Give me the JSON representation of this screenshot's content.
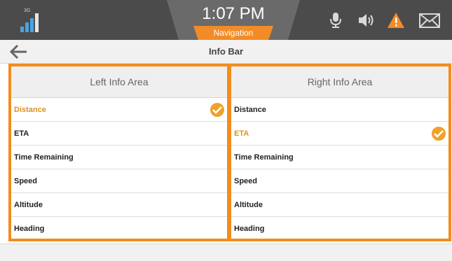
{
  "status_bar": {
    "network_label": "3G",
    "time": "1:07 PM",
    "mode_tab": "Navigation",
    "icons": [
      "signal-icon",
      "microphone-icon",
      "speaker-icon",
      "warning-icon",
      "mail-icon"
    ],
    "colors": {
      "accent": "#f28c28",
      "signal": "#4aa3df",
      "warning": "#f28c28"
    }
  },
  "title_bar": {
    "title": "Info Bar",
    "back_icon": "back-arrow-icon"
  },
  "left_area": {
    "header": "Left Info Area",
    "items": [
      {
        "label": "Distance",
        "selected": true
      },
      {
        "label": "ETA",
        "selected": false
      },
      {
        "label": "Time Remaining",
        "selected": false
      },
      {
        "label": "Speed",
        "selected": false
      },
      {
        "label": "Altitude",
        "selected": false
      },
      {
        "label": "Heading",
        "selected": false
      }
    ]
  },
  "right_area": {
    "header": "Right Info Area",
    "items": [
      {
        "label": "Distance",
        "selected": false
      },
      {
        "label": "ETA",
        "selected": true
      },
      {
        "label": "Time Remaining",
        "selected": false
      },
      {
        "label": "Speed",
        "selected": false
      },
      {
        "label": "Altitude",
        "selected": false
      },
      {
        "label": "Heading",
        "selected": false
      }
    ]
  },
  "selection_color": "#f0a12a"
}
